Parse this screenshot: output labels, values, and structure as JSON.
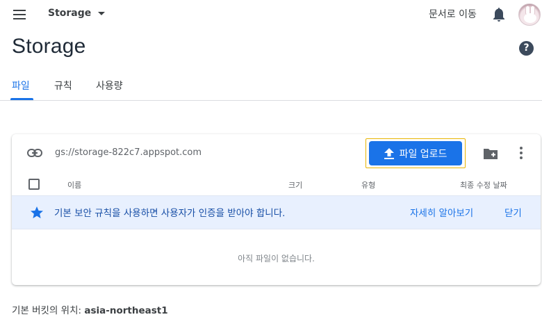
{
  "topbar": {
    "project_name": "Storage",
    "docs_link": "문서로 이동"
  },
  "page": {
    "title": "Storage"
  },
  "tabs": [
    {
      "label": "파일",
      "active": true
    },
    {
      "label": "규칙",
      "active": false
    },
    {
      "label": "사용량",
      "active": false
    }
  ],
  "card": {
    "bucket_url": "gs://storage-822c7.appspot.com",
    "upload_label": "파일 업로드",
    "columns": {
      "name": "이름",
      "size": "크기",
      "type": "유형",
      "modified": "최종 수정 날짜"
    },
    "banner": {
      "text": "기본 보안 규칙을 사용하면 사용자가 인증을 받아야 합니다.",
      "learn_more": "자세히 알아보기",
      "close": "닫기"
    },
    "empty_text": "아직 파일이 없습니다."
  },
  "footer": {
    "label": "기본 버킷의 위치: ",
    "location": "asia-northeast1"
  },
  "colors": {
    "accent": "#1a73e8",
    "banner_bg": "#e8f0fe",
    "highlight_border": "#e8b400"
  },
  "icons": [
    "menu-icon",
    "chevron-down-icon",
    "bell-icon",
    "help-icon",
    "link-icon",
    "upload-icon",
    "new-folder-icon",
    "more-vert-icon",
    "star-icon"
  ]
}
